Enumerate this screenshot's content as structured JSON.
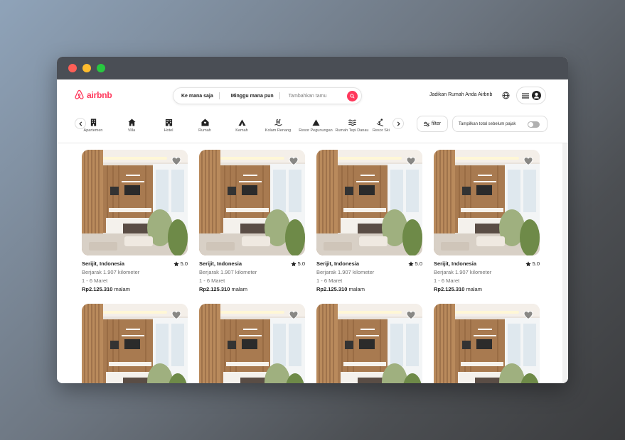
{
  "brand": {
    "name": "airbnb",
    "color": "#ff385c"
  },
  "search": {
    "location": "Ke mana saja",
    "week": "Minggu mana pun",
    "guests": "Tambahkan tamu"
  },
  "header": {
    "host_link": "Jadikan Rumah Anda Airbnb"
  },
  "categories": [
    {
      "label": "Apartemen",
      "icon": "building-icon"
    },
    {
      "label": "Villa",
      "icon": "house-icon"
    },
    {
      "label": "Hotel",
      "icon": "hotel-icon"
    },
    {
      "label": "Rumah",
      "icon": "home-icon"
    },
    {
      "label": "Kemah",
      "icon": "tent-icon"
    },
    {
      "label": "Kolam Renang",
      "icon": "pool-icon"
    },
    {
      "label": "Resor Pegunungan",
      "icon": "mountain-icon"
    },
    {
      "label": "Rumah Tepi Danau",
      "icon": "waves-icon"
    },
    {
      "label": "Resor Ski",
      "icon": "ski-icon"
    }
  ],
  "filters": {
    "filter_label": "filter",
    "tax_label": "Tampilkan total sebelum pajak"
  },
  "listings": [
    {
      "location": "Serijit, Indonesia",
      "rating": "5.0",
      "distance": "Berjarak 1.907 kilometer",
      "dates": "1 - 6 Maret",
      "price": "Rp2.125.310",
      "unit": "malam"
    },
    {
      "location": "Serijit, Indonesia",
      "rating": "5.0",
      "distance": "Berjarak 1.907 kilometer",
      "dates": "1 - 6 Maret",
      "price": "Rp2.125.310",
      "unit": "malam"
    },
    {
      "location": "Serijit, Indonesia",
      "rating": "5.0",
      "distance": "Berjarak 1.907 kilometer",
      "dates": "1 - 6 Maret",
      "price": "Rp2.125.310",
      "unit": "malam"
    },
    {
      "location": "Serijit, Indonesia",
      "rating": "5.0",
      "distance": "Berjarak 1.907 kilometer",
      "dates": "1 - 6 Maret",
      "price": "Rp2.125.310",
      "unit": "malam"
    },
    {
      "location": "",
      "rating": "",
      "distance": "",
      "dates": "",
      "price": "",
      "unit": ""
    },
    {
      "location": "",
      "rating": "",
      "distance": "",
      "dates": "",
      "price": "",
      "unit": ""
    },
    {
      "location": "",
      "rating": "",
      "distance": "",
      "dates": "",
      "price": "",
      "unit": ""
    },
    {
      "location": "",
      "rating": "",
      "distance": "",
      "dates": "",
      "price": "",
      "unit": ""
    }
  ]
}
